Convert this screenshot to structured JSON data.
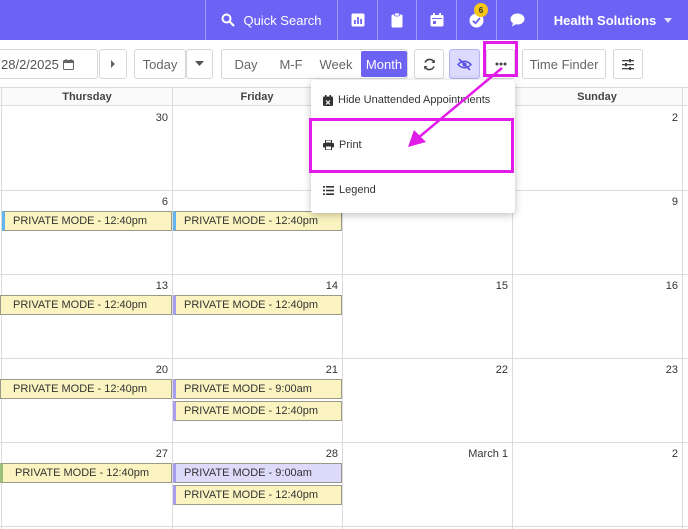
{
  "topbar": {
    "search_label": "Quick Search",
    "notification_count": "6",
    "org_name": "Health Solutions",
    "accent_color": "#6c63f5"
  },
  "toolbar": {
    "date_value": "28/2/2025",
    "today_label": "Today",
    "views": [
      "Day",
      "M-F",
      "Week",
      "Month"
    ],
    "active_view": "Month",
    "time_finder_label": "Time Finder"
  },
  "calendar": {
    "headers": [
      "Thursday",
      "Friday",
      "Sunday"
    ],
    "weeks": [
      {
        "days": [
          "30",
          "",
          "2"
        ]
      },
      {
        "days": [
          "6",
          "",
          "9"
        ]
      },
      {
        "days": [
          "13",
          "14",
          "15",
          "16"
        ]
      },
      {
        "days": [
          "20",
          "21",
          "22",
          "23"
        ]
      },
      {
        "days": [
          "27",
          "28",
          "March 1",
          "2"
        ]
      }
    ],
    "events": {
      "w2_wed": "PRIVATE MODE - 12:40pm",
      "w2_thu": "PRIVATE MODE - 12:40pm",
      "w3_wed": "PRIVATE MODE - 12:40pm",
      "w3_thu": "PRIVATE MODE - 12:40pm",
      "w4_wed": "PRIVATE MODE - 12:40pm",
      "w4_thu_1": "PRIVATE MODE - 9:00am",
      "w4_thu_2": "PRIVATE MODE - 12:40pm",
      "w5_wed": "PRIVATE MODE - 12:40pm",
      "w5_thu_1": "PRIVATE MODE - 9:00am",
      "w5_thu_2": "PRIVATE MODE - 12:40pm"
    }
  },
  "menu": {
    "items": [
      "Hide Unattended Appointments",
      "Print",
      "Legend"
    ]
  },
  "highlight_color": "#e21ce8",
  "icons": [
    "search-icon",
    "chart-icon",
    "clipboard-icon",
    "calendar-icon",
    "check-icon",
    "chat-icon",
    "calendar-small-icon",
    "chevron-right-icon",
    "caret-down-icon",
    "refresh-icon",
    "eye-off-icon",
    "ellipsis-icon",
    "sliders-icon",
    "calendar-x-icon",
    "printer-icon",
    "list-icon"
  ]
}
